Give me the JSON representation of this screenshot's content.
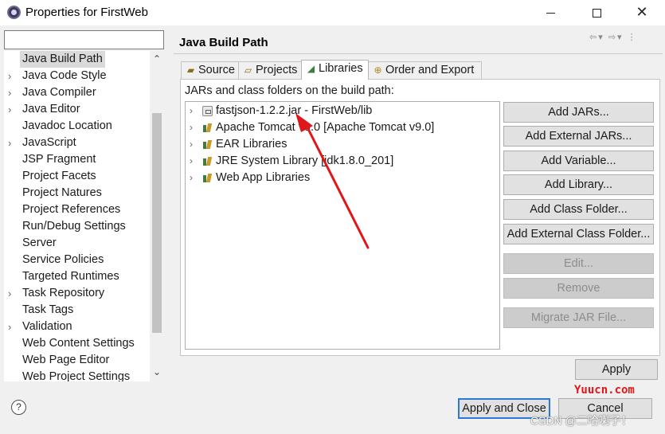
{
  "window": {
    "title": "Properties for FirstWeb",
    "minimize_icon": "minimize-icon",
    "maximize_icon": "maximize-icon",
    "close_glyph": "✕"
  },
  "filter": {
    "value": "",
    "placeholder": ""
  },
  "tree": {
    "items": [
      {
        "label": "Java Build Path",
        "expandable": false,
        "selected": true
      },
      {
        "label": "Java Code Style",
        "expandable": true
      },
      {
        "label": "Java Compiler",
        "expandable": true
      },
      {
        "label": "Java Editor",
        "expandable": true
      },
      {
        "label": "Javadoc Location",
        "expandable": false
      },
      {
        "label": "JavaScript",
        "expandable": true
      },
      {
        "label": "JSP Fragment",
        "expandable": false
      },
      {
        "label": "Project Facets",
        "expandable": false
      },
      {
        "label": "Project Natures",
        "expandable": false
      },
      {
        "label": "Project References",
        "expandable": false
      },
      {
        "label": "Run/Debug Settings",
        "expandable": false
      },
      {
        "label": "Server",
        "expandable": false
      },
      {
        "label": "Service Policies",
        "expandable": false
      },
      {
        "label": "Targeted Runtimes",
        "expandable": false
      },
      {
        "label": "Task Repository",
        "expandable": true
      },
      {
        "label": "Task Tags",
        "expandable": false
      },
      {
        "label": "Validation",
        "expandable": true
      },
      {
        "label": "Web Content Settings",
        "expandable": false
      },
      {
        "label": "Web Page Editor",
        "expandable": false
      },
      {
        "label": "Web Project Settings",
        "expandable": false
      }
    ]
  },
  "page": {
    "title": "Java Build Path",
    "tabs": [
      {
        "label": "Source",
        "icon": "source-folder-icon"
      },
      {
        "label": "Projects",
        "icon": "projects-icon"
      },
      {
        "label": "Libraries",
        "icon": "libraries-icon",
        "active": true
      },
      {
        "label": "Order and Export",
        "icon": "order-export-icon"
      }
    ],
    "section_label": "JARs and class folders on the build path:",
    "libraries": [
      {
        "label": "fastjson-1.2.2.jar - FirstWeb/lib",
        "icon": "jar-icon"
      },
      {
        "label": "Apache Tomcat v9.0 [Apache Tomcat v9.0]",
        "icon": "library-icon"
      },
      {
        "label": "EAR Libraries",
        "icon": "library-icon"
      },
      {
        "label": "JRE System Library [jdk1.8.0_201]",
        "icon": "library-icon"
      },
      {
        "label": "Web App Libraries",
        "icon": "library-icon"
      }
    ],
    "buttons": {
      "add_jars": "Add JARs...",
      "add_external_jars": "Add External JARs...",
      "add_variable": "Add Variable...",
      "add_library": "Add Library...",
      "add_class_folder": "Add Class Folder...",
      "add_external_class_folder": "Add External Class Folder...",
      "edit": "Edit...",
      "remove": "Remove",
      "migrate_jar": "Migrate JAR File...",
      "apply": "Apply"
    }
  },
  "footer": {
    "help_glyph": "?",
    "apply_and_close": "Apply and Close",
    "cancel": "Cancel"
  },
  "annotation": {
    "color": "#e0161b"
  },
  "watermarks": {
    "yuucn": "Yuucn.com",
    "csdn": "CSDN @二哈喇子！"
  }
}
